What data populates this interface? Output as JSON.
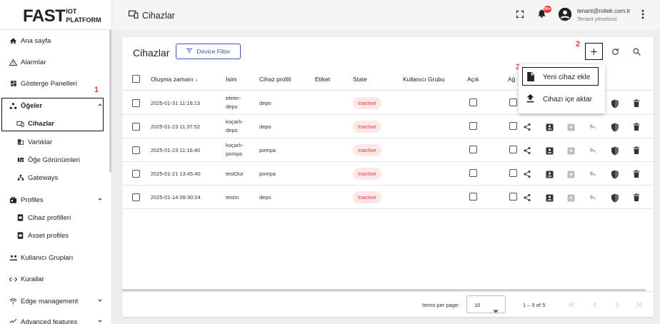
{
  "logo": {
    "main": "FAST",
    "sub": "IOT PLATFORM"
  },
  "sidebar": {
    "items": [
      {
        "label": "Ana sayfa",
        "icon": "home-icon"
      },
      {
        "label": "Alarmlar",
        "icon": "warning-icon"
      },
      {
        "label": "Gösterge Panelleri",
        "icon": "dashboard-icon"
      },
      {
        "label": "Öğeler",
        "icon": "entities-icon",
        "expanded": true
      },
      {
        "label": "Cihazlar",
        "icon": "devices-icon",
        "active": true
      },
      {
        "label": "Varlıklar",
        "icon": "domain-icon"
      },
      {
        "label": "Öğe Görünümleri",
        "icon": "view-quilt-icon"
      },
      {
        "label": "Gateways",
        "icon": "gateway-icon"
      },
      {
        "label": "Profiles",
        "icon": "profiles-icon",
        "expanded": true
      },
      {
        "label": "Cihaz profilleri",
        "icon": "device-profile-icon"
      },
      {
        "label": "Asset profiles",
        "icon": "asset-profile-icon"
      },
      {
        "label": "Kullanıcı Grupları",
        "icon": "groups-icon"
      },
      {
        "label": "Kurallar",
        "icon": "code-icon"
      },
      {
        "label": "Edge management",
        "icon": "edge-icon",
        "expanded": false
      },
      {
        "label": "Advanced features",
        "icon": "advanced-icon",
        "expanded": false
      }
    ]
  },
  "topbar": {
    "title": "Cihazlar",
    "notification_count": "99+",
    "user_email": "tenant@roltek.com.tr",
    "user_role": "Tenant yöneticisi"
  },
  "card": {
    "title": "Cihazlar",
    "filter_label": "Device Filter"
  },
  "annotations": {
    "one": "1",
    "two": "2",
    "three": "3"
  },
  "table": {
    "headers": {
      "created": "Oluşma zamanı",
      "name": "İsim",
      "profile": "Cihaz profili",
      "label": "Etiket",
      "state": "State",
      "group": "Kullanıcı Grubu",
      "public": "Açık",
      "gateway": "Ağ"
    },
    "rows": [
      {
        "created": "2025-01-31 11:16:13",
        "name1": "efeler-",
        "name2": "depo",
        "profile": "depo",
        "state": "Inactive"
      },
      {
        "created": "2025-01-23 11:37:52",
        "name1": "koçarlı-",
        "name2": "depo",
        "profile": "depo",
        "state": "Inactive"
      },
      {
        "created": "2025-01-23 11:16:40",
        "name1": "koçarlı-",
        "name2": "pompa",
        "profile": "pompa",
        "state": "Inactive"
      },
      {
        "created": "2025-01-21 13:45:40",
        "name1": "testOut",
        "name2": "",
        "profile": "pompa",
        "state": "Inactive"
      },
      {
        "created": "2025-01-14 09:30:24",
        "name1": "testIn",
        "name2": "",
        "profile": "depo",
        "state": "Inactive"
      }
    ]
  },
  "footer": {
    "items_per_page_label": "Items per page:",
    "items_per_page": "10",
    "range": "1 – 5 of 5"
  },
  "menu": {
    "add_device": "Yeni cihaz ekle",
    "import_device": "Cihazı içe aktar"
  },
  "colors": {
    "accent": "#3f51b5",
    "inactive": "#e53935",
    "annotation": "#e53935"
  }
}
